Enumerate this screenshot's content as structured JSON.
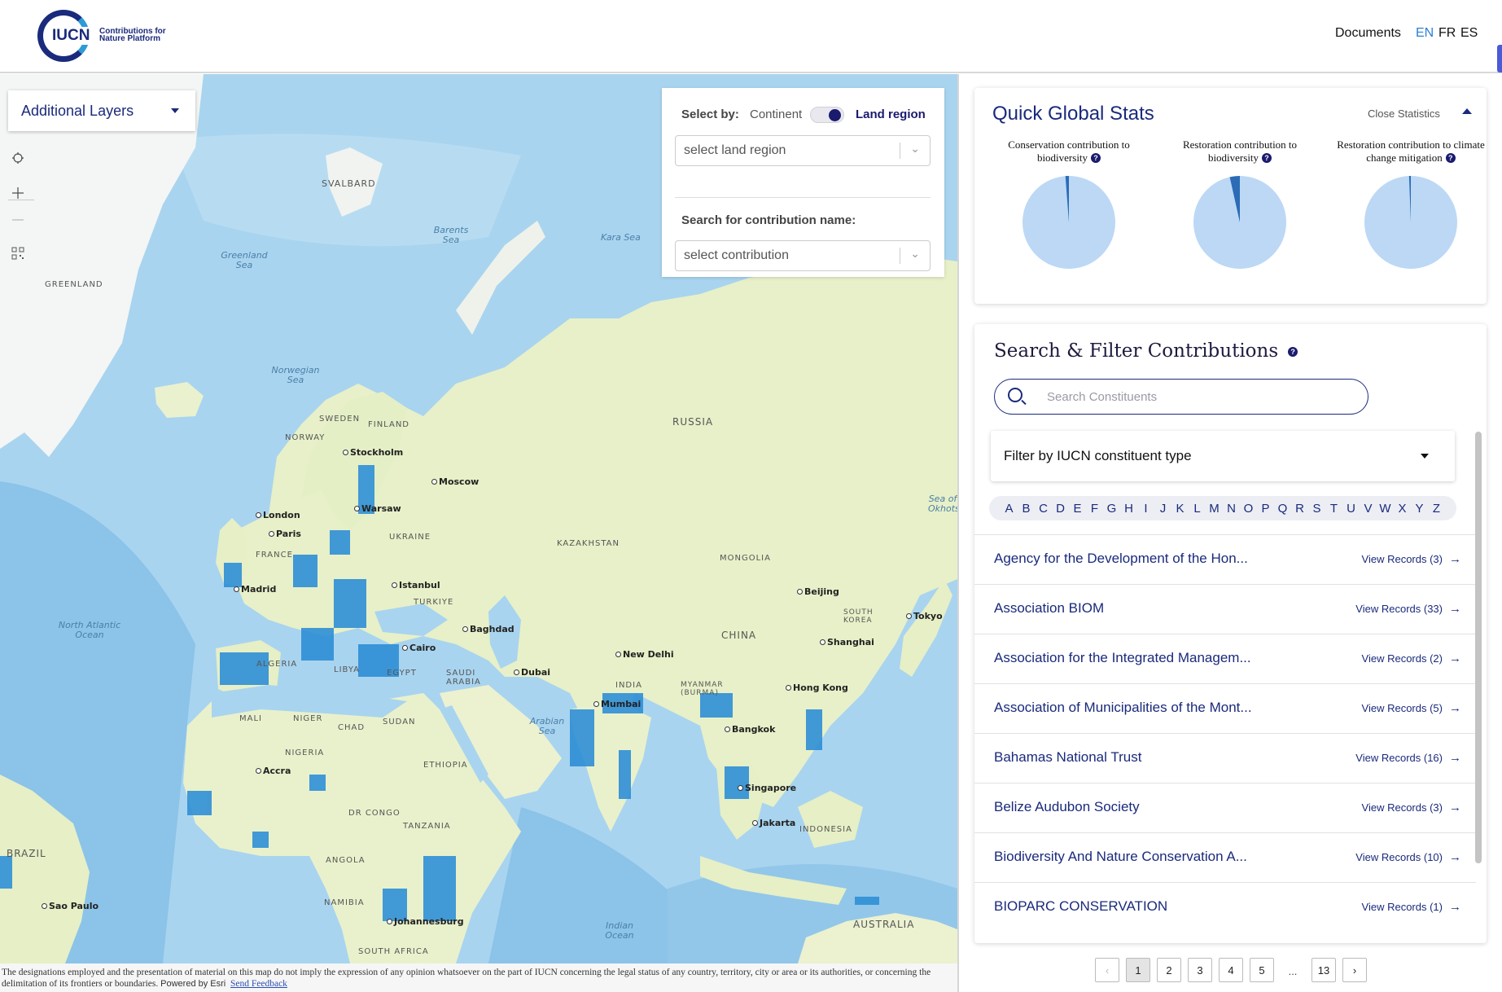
{
  "header": {
    "logo_main": "IUCN",
    "logo_sub": "Contributions for Nature Platform",
    "nav_documents": "Documents",
    "languages": [
      "EN",
      "FR",
      "ES"
    ],
    "active_language": "EN"
  },
  "map": {
    "layers_button": "Additional Layers",
    "tools": [
      "locate-icon",
      "zoom-in-icon",
      "zoom-out-icon",
      "qr-grid-icon"
    ],
    "select_by_label": "Select by:",
    "toggle_left": "Continent",
    "toggle_right": "Land region",
    "land_region_placeholder": "select land region",
    "search_contribution_label": "Search for contribution name:",
    "contribution_placeholder": "select contribution",
    "country_labels": [
      "SVALBARD",
      "GREENLAND",
      "RUSSIA",
      "FINLAND",
      "SWEDEN",
      "NORWAY",
      "UKRAINE",
      "FRANCE",
      "KAZAKHSTAN",
      "MONGOLIA",
      "CHINA",
      "SOUTH KOREA",
      "ALGERIA",
      "LIBYA",
      "EGYPT",
      "SAUDI ARABIA",
      "INDIA",
      "MYANMAR (BURMA)",
      "MALI",
      "NIGER",
      "CHAD",
      "SUDAN",
      "NIGERIA",
      "ETHIOPIA",
      "DR CONGO",
      "TANZANIA",
      "ANGOLA",
      "NAMIBIA",
      "SOUTH AFRICA",
      "BRAZIL",
      "AUSTRALIA",
      "INDONESIA",
      "TURKIYE"
    ],
    "sea_labels": [
      "Barents Sea",
      "Kara Sea",
      "Greenland Sea",
      "Norwegian Sea",
      "North Atlantic Ocean",
      "Arabian Sea",
      "Indian Ocean",
      "Sea of Okhotsk"
    ],
    "cities": [
      "Stockholm",
      "Moscow",
      "London",
      "Paris",
      "Warsaw",
      "Madrid",
      "Istanbul",
      "Baghdad",
      "Cairo",
      "Dubai",
      "New Delhi",
      "Mumbai",
      "Beijing",
      "Tokyo",
      "Shanghai",
      "Hong Kong",
      "Bangkok",
      "Singapore",
      "Jakarta",
      "Accra",
      "Johannesburg",
      "Sao Paulo"
    ],
    "disclaimer": "The designations employed and the presentation of material on this map do not imply the expression of any opinion whatsoever on the part of IUCN concerning the legal status of any country, territory, city or area or its authorities, or concerning the delimitation of its frontiers or boundaries.",
    "powered_by": "Powered by Esri",
    "feedback_link": "Send Feedback"
  },
  "stats": {
    "title": "Quick Global Stats",
    "close_label": "Close Statistics",
    "items": [
      {
        "label": "Conservation contribution to biodiversity",
        "fraction": 0.012
      },
      {
        "label": "Restoration contribution to biodiversity",
        "fraction": 0.035
      },
      {
        "label": "Restoration contribution to climate change mitigation",
        "fraction": 0.006
      }
    ],
    "pie_light": "#bcd8f5",
    "pie_dark": "#2c6cb6"
  },
  "filter": {
    "title": "Search & Filter Contributions",
    "search_placeholder": "Search Constituents",
    "type_filter": "Filter by IUCN constituent type",
    "letters": [
      "A",
      "B",
      "C",
      "D",
      "E",
      "F",
      "G",
      "H",
      "I",
      "J",
      "K",
      "L",
      "M",
      "N",
      "O",
      "P",
      "Q",
      "R",
      "S",
      "T",
      "U",
      "V",
      "W",
      "X",
      "Y",
      "Z"
    ],
    "rows": [
      {
        "name": "Agency for the Development of the Hon...",
        "link": "View Records (3)"
      },
      {
        "name": "Association BIOM",
        "link": "View Records (33)"
      },
      {
        "name": "Association for the Integrated Managem...",
        "link": "View Records (2)"
      },
      {
        "name": "Association of Municipalities of the Mont...",
        "link": "View Records (5)"
      },
      {
        "name": "Bahamas National Trust",
        "link": "View Records (16)"
      },
      {
        "name": "Belize Audubon Society",
        "link": "View Records (3)"
      },
      {
        "name": "Biodiversity And Nature Conservation A...",
        "link": "View Records (10)"
      },
      {
        "name": "BIOPARC CONSERVATION",
        "link": "View Records (1)"
      }
    ]
  },
  "pagination": {
    "pages": [
      "1",
      "2",
      "3",
      "4",
      "5",
      "...",
      "13"
    ],
    "current": "1"
  }
}
